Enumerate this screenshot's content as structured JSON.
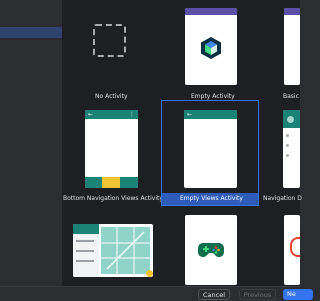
{
  "gallery": {
    "tiles": [
      {
        "label": "No Activity"
      },
      {
        "label": "Empty Activity"
      },
      {
        "label": "Basic"
      },
      {
        "label": "Bottom Navigation Views Activity"
      },
      {
        "label": "Empty Views Activity",
        "selected": true
      },
      {
        "label": "Navigation D"
      },
      {
        "label": ""
      },
      {
        "label": ""
      },
      {
        "label": ""
      }
    ]
  },
  "footer": {
    "cancel_label": "Cancel",
    "previous_label": "Previous",
    "next_label": "Ne"
  },
  "colors": {
    "accent": "#3574f0",
    "teal": "#1b8276",
    "purple": "#5b4fa6",
    "yellow": "#f1c232"
  },
  "icons": {
    "back": "←",
    "overflow": "⋮"
  }
}
